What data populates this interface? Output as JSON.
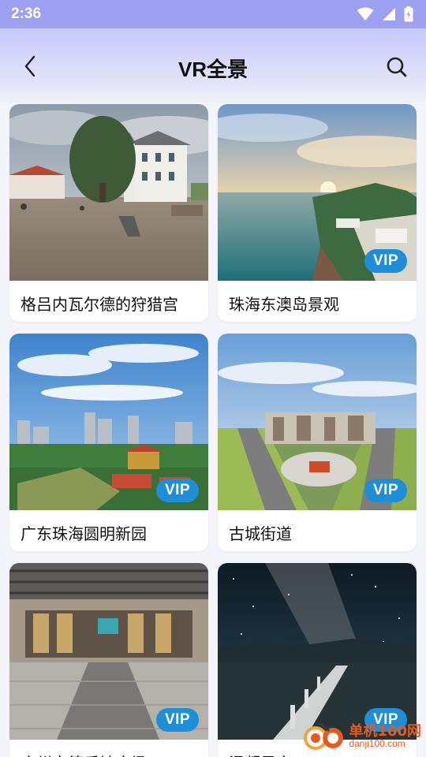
{
  "status_bar": {
    "time": "2:36"
  },
  "header": {
    "title": "VR全景"
  },
  "cards": [
    {
      "title": "格吕内瓦尔德的狩猎宫",
      "vip": ""
    },
    {
      "title": "珠海东澳岛景观",
      "vip": "VIP"
    },
    {
      "title": "广东珠海圆明新园",
      "vip": "VIP"
    },
    {
      "title": "古城街道",
      "vip": "VIP"
    },
    {
      "title": "广州亦德乐地广场",
      "vip": "VIP"
    },
    {
      "title": "混凝星空",
      "vip": "VIP"
    }
  ],
  "watermark": {
    "site": "单机100网",
    "url": "danji100.com"
  },
  "colors": {
    "status_bar": "#9d9ff0",
    "vip_badge": "#1e8fd6",
    "watermark": "#e85a1c"
  }
}
